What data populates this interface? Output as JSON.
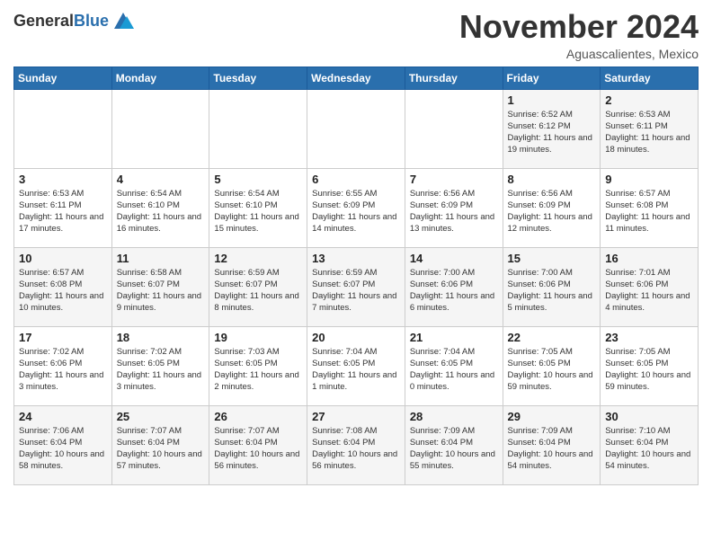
{
  "header": {
    "logo_general": "General",
    "logo_blue": "Blue",
    "month_title": "November 2024",
    "subtitle": "Aguascalientes, Mexico"
  },
  "days_of_week": [
    "Sunday",
    "Monday",
    "Tuesday",
    "Wednesday",
    "Thursday",
    "Friday",
    "Saturday"
  ],
  "weeks": [
    [
      {
        "day": "",
        "info": ""
      },
      {
        "day": "",
        "info": ""
      },
      {
        "day": "",
        "info": ""
      },
      {
        "day": "",
        "info": ""
      },
      {
        "day": "",
        "info": ""
      },
      {
        "day": "1",
        "info": "Sunrise: 6:52 AM\nSunset: 6:12 PM\nDaylight: 11 hours and 19 minutes."
      },
      {
        "day": "2",
        "info": "Sunrise: 6:53 AM\nSunset: 6:11 PM\nDaylight: 11 hours and 18 minutes."
      }
    ],
    [
      {
        "day": "3",
        "info": "Sunrise: 6:53 AM\nSunset: 6:11 PM\nDaylight: 11 hours and 17 minutes."
      },
      {
        "day": "4",
        "info": "Sunrise: 6:54 AM\nSunset: 6:10 PM\nDaylight: 11 hours and 16 minutes."
      },
      {
        "day": "5",
        "info": "Sunrise: 6:54 AM\nSunset: 6:10 PM\nDaylight: 11 hours and 15 minutes."
      },
      {
        "day": "6",
        "info": "Sunrise: 6:55 AM\nSunset: 6:09 PM\nDaylight: 11 hours and 14 minutes."
      },
      {
        "day": "7",
        "info": "Sunrise: 6:56 AM\nSunset: 6:09 PM\nDaylight: 11 hours and 13 minutes."
      },
      {
        "day": "8",
        "info": "Sunrise: 6:56 AM\nSunset: 6:09 PM\nDaylight: 11 hours and 12 minutes."
      },
      {
        "day": "9",
        "info": "Sunrise: 6:57 AM\nSunset: 6:08 PM\nDaylight: 11 hours and 11 minutes."
      }
    ],
    [
      {
        "day": "10",
        "info": "Sunrise: 6:57 AM\nSunset: 6:08 PM\nDaylight: 11 hours and 10 minutes."
      },
      {
        "day": "11",
        "info": "Sunrise: 6:58 AM\nSunset: 6:07 PM\nDaylight: 11 hours and 9 minutes."
      },
      {
        "day": "12",
        "info": "Sunrise: 6:59 AM\nSunset: 6:07 PM\nDaylight: 11 hours and 8 minutes."
      },
      {
        "day": "13",
        "info": "Sunrise: 6:59 AM\nSunset: 6:07 PM\nDaylight: 11 hours and 7 minutes."
      },
      {
        "day": "14",
        "info": "Sunrise: 7:00 AM\nSunset: 6:06 PM\nDaylight: 11 hours and 6 minutes."
      },
      {
        "day": "15",
        "info": "Sunrise: 7:00 AM\nSunset: 6:06 PM\nDaylight: 11 hours and 5 minutes."
      },
      {
        "day": "16",
        "info": "Sunrise: 7:01 AM\nSunset: 6:06 PM\nDaylight: 11 hours and 4 minutes."
      }
    ],
    [
      {
        "day": "17",
        "info": "Sunrise: 7:02 AM\nSunset: 6:06 PM\nDaylight: 11 hours and 3 minutes."
      },
      {
        "day": "18",
        "info": "Sunrise: 7:02 AM\nSunset: 6:05 PM\nDaylight: 11 hours and 3 minutes."
      },
      {
        "day": "19",
        "info": "Sunrise: 7:03 AM\nSunset: 6:05 PM\nDaylight: 11 hours and 2 minutes."
      },
      {
        "day": "20",
        "info": "Sunrise: 7:04 AM\nSunset: 6:05 PM\nDaylight: 11 hours and 1 minute."
      },
      {
        "day": "21",
        "info": "Sunrise: 7:04 AM\nSunset: 6:05 PM\nDaylight: 11 hours and 0 minutes."
      },
      {
        "day": "22",
        "info": "Sunrise: 7:05 AM\nSunset: 6:05 PM\nDaylight: 10 hours and 59 minutes."
      },
      {
        "day": "23",
        "info": "Sunrise: 7:05 AM\nSunset: 6:05 PM\nDaylight: 10 hours and 59 minutes."
      }
    ],
    [
      {
        "day": "24",
        "info": "Sunrise: 7:06 AM\nSunset: 6:04 PM\nDaylight: 10 hours and 58 minutes."
      },
      {
        "day": "25",
        "info": "Sunrise: 7:07 AM\nSunset: 6:04 PM\nDaylight: 10 hours and 57 minutes."
      },
      {
        "day": "26",
        "info": "Sunrise: 7:07 AM\nSunset: 6:04 PM\nDaylight: 10 hours and 56 minutes."
      },
      {
        "day": "27",
        "info": "Sunrise: 7:08 AM\nSunset: 6:04 PM\nDaylight: 10 hours and 56 minutes."
      },
      {
        "day": "28",
        "info": "Sunrise: 7:09 AM\nSunset: 6:04 PM\nDaylight: 10 hours and 55 minutes."
      },
      {
        "day": "29",
        "info": "Sunrise: 7:09 AM\nSunset: 6:04 PM\nDaylight: 10 hours and 54 minutes."
      },
      {
        "day": "30",
        "info": "Sunrise: 7:10 AM\nSunset: 6:04 PM\nDaylight: 10 hours and 54 minutes."
      }
    ]
  ]
}
